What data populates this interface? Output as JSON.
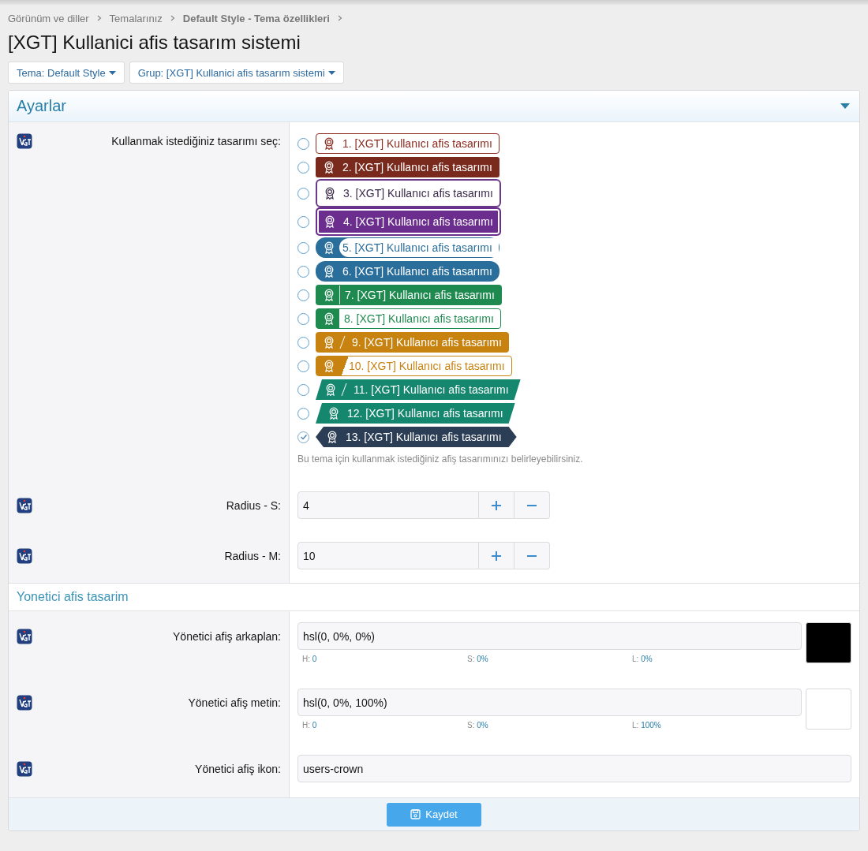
{
  "breadcrumb": [
    {
      "label": "Görünüm ve diller",
      "current": false
    },
    {
      "label": "Temalarınız",
      "current": false
    },
    {
      "label": "Default Style - Tema özellikleri",
      "current": true
    }
  ],
  "title": "[XGT] Kullanici afis tasarım sistemi",
  "filters": [
    {
      "label": "Tema: Default Style"
    },
    {
      "label": "Grup: [XGT] Kullanici afis tasarım sistemi"
    }
  ],
  "settings": {
    "title": "Ayarlar",
    "expanded": true,
    "banner_option": {
      "label": "Kullanmak istediğiniz tasarımı seç:",
      "hint": "Bu tema için kullanmak istediğiniz afiş tasarımınızı belirleyebilirsiniz.",
      "options": [
        {
          "label": "1. [XGT] Kullanıcı afis tasarımı",
          "kind": "outline",
          "color": "#8b2a1e",
          "selected": false
        },
        {
          "label": "2. [XGT] Kullanıcı afis tasarımı",
          "kind": "solid",
          "color": "#7a2a1c",
          "selected": false
        },
        {
          "label": "3. [XGT] Kullanıcı afis tasarımı",
          "kind": "framed",
          "color": "#6a3a8a",
          "selected": false
        },
        {
          "label": "4. [XGT] Kullanıcı afis tasarımı",
          "kind": "framed-solid",
          "color": "#6c2e8e",
          "selected": false
        },
        {
          "label": "5. [XGT] Kullanıcı afis tasarımı",
          "kind": "split-pill",
          "color": "#2a6e9c",
          "selected": false
        },
        {
          "label": "6. [XGT] Kullanıcı afis tasarımı",
          "kind": "pill",
          "color": "#2a6e9c",
          "selected": false
        },
        {
          "label": "7. [XGT] Kullanıcı afis tasarımı",
          "kind": "divided",
          "color": "#1f8a4f",
          "selected": false
        },
        {
          "label": "8. [XGT] Kullanıcı afis tasarımı",
          "kind": "split",
          "color": "#1f8a4f",
          "selected": false
        },
        {
          "label": "9. [XGT] Kullanıcı afis tasarımı",
          "kind": "slash",
          "color": "#c8820f",
          "selected": false
        },
        {
          "label": "10. [XGT] Kullanıcı afis tasarımı",
          "kind": "slash-split",
          "color": "#c8820f",
          "selected": false
        },
        {
          "label": "11. [XGT] Kullanıcı afis tasarımı",
          "kind": "skew-slash",
          "color": "#16876f",
          "selected": false
        },
        {
          "label": "12. [XGT] Kullanıcı afis tasarımı",
          "kind": "skew",
          "color": "#16876f",
          "selected": false
        },
        {
          "label": "13. [XGT] Kullanıcı afis tasarımı",
          "kind": "arrow",
          "color": "#2c3e55",
          "selected": true
        }
      ]
    },
    "number_fields": [
      {
        "label": "Radius - S:",
        "value": "4"
      },
      {
        "label": "Radius - M:",
        "value": "10"
      }
    ]
  },
  "admin": {
    "title": "Yonetici afis tasarim",
    "color_fields": [
      {
        "label": "Yönetici afiş arkaplan:",
        "value": "hsl(0, 0%, 0%)",
        "color": "#000000",
        "channels": [
          {
            "label": "H:",
            "value": "0"
          },
          {
            "label": "S:",
            "value": "0%"
          },
          {
            "label": "L:",
            "value": "0%"
          }
        ]
      },
      {
        "label": "Yönetici afiş metin:",
        "value": "hsl(0, 0%, 100%)",
        "color": "#ffffff",
        "channels": [
          {
            "label": "H:",
            "value": "0"
          },
          {
            "label": "S:",
            "value": "0%"
          },
          {
            "label": "L:",
            "value": "100%"
          }
        ]
      }
    ],
    "text_fields": [
      {
        "label": "Yönetici afiş ikon:",
        "value": "users-crown"
      }
    ]
  },
  "save_button": "Kaydet"
}
